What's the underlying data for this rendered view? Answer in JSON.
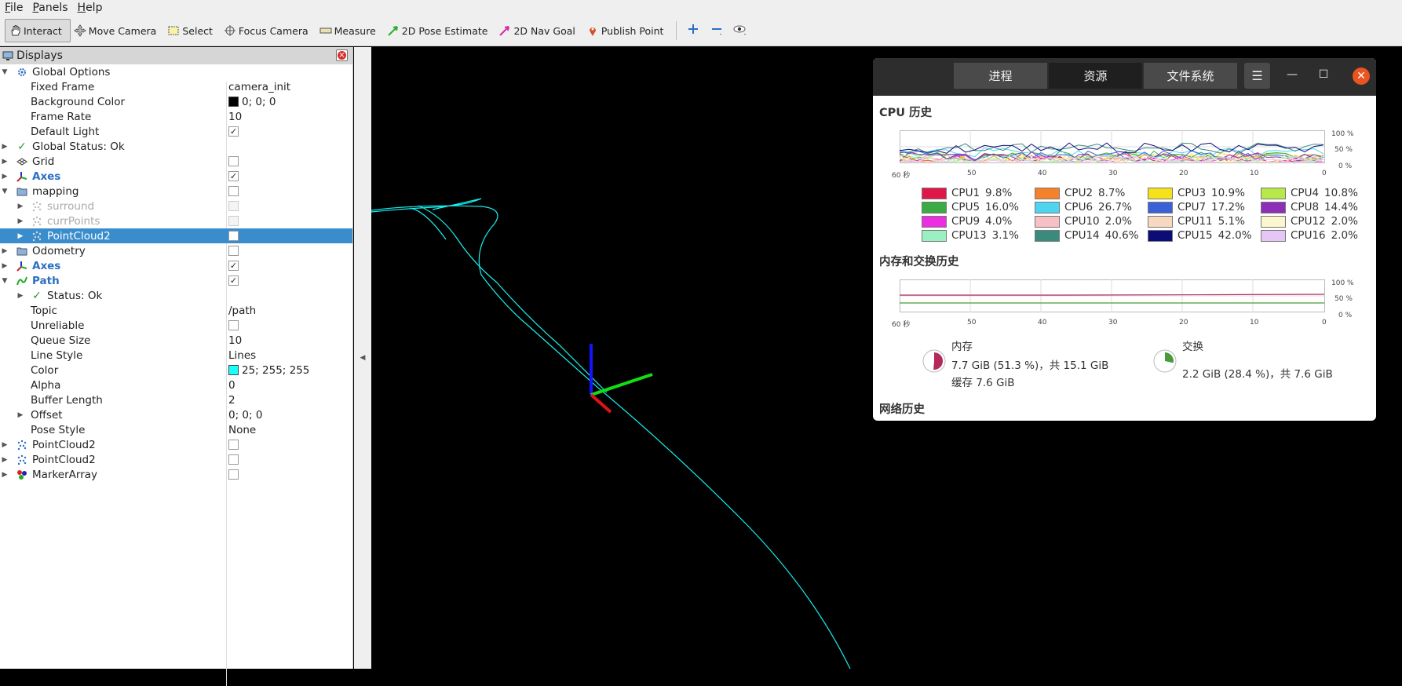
{
  "menubar": {
    "items": [
      {
        "label": "File",
        "mnemonic": "F",
        "rest": "ile"
      },
      {
        "label": "Panels",
        "mnemonic": "P",
        "rest": "anels"
      },
      {
        "label": "Help",
        "mnemonic": "H",
        "rest": "elp"
      }
    ]
  },
  "toolbar": {
    "interact": "Interact",
    "move_camera": "Move Camera",
    "select": "Select",
    "focus_camera": "Focus Camera",
    "measure": "Measure",
    "pose_estimate": "2D Pose Estimate",
    "nav_goal": "2D Nav Goal",
    "publish_point": "Publish Point"
  },
  "displays": {
    "title": "Displays",
    "rows": {
      "global_options": "Global Options",
      "fixed_frame": "Fixed Frame",
      "fixed_frame_val": "camera_init",
      "background_color": "Background Color",
      "background_color_val": "0; 0; 0",
      "frame_rate": "Frame Rate",
      "frame_rate_val": "10",
      "default_light": "Default Light",
      "global_status": "Global Status: Ok",
      "grid": "Grid",
      "axes": "Axes",
      "mapping": "mapping",
      "surround": "surround",
      "currpoints": "currPoints",
      "pointcloud2_sel": "PointCloud2",
      "odometry": "Odometry",
      "axes2": "Axes",
      "path": "Path",
      "status_ok": "Status: Ok",
      "topic": "Topic",
      "topic_val": "/path",
      "unreliable": "Unreliable",
      "queue_size": "Queue Size",
      "queue_size_val": "10",
      "line_style": "Line Style",
      "line_style_val": "Lines",
      "color": "Color",
      "color_val": "25; 255; 255",
      "alpha": "Alpha",
      "alpha_val": "0",
      "buffer_length": "Buffer Length",
      "buffer_length_val": "2",
      "offset": "Offset",
      "offset_val": "0; 0; 0",
      "pose_style": "Pose Style",
      "pose_style_val": "None",
      "pointcloud2_a": "PointCloud2",
      "pointcloud2_b": "PointCloud2",
      "marker_array": "MarkerArray"
    }
  },
  "sysmon": {
    "tabs": [
      "进程",
      "资源",
      "文件系统"
    ],
    "cpu_title": "CPU 历史",
    "mem_title": "内存和交换历史",
    "net_title": "网络历史",
    "y_ticks": [
      "100 %",
      "50 %",
      "0 %"
    ],
    "x_ticks": [
      "60 秒",
      "50",
      "40",
      "30",
      "20",
      "10",
      "0"
    ],
    "cpus": [
      {
        "label": "CPU1",
        "value": "9.8%",
        "color": "#e0184a"
      },
      {
        "label": "CPU2",
        "value": "8.7%",
        "color": "#f5822a"
      },
      {
        "label": "CPU3",
        "value": "10.9%",
        "color": "#f7e11a"
      },
      {
        "label": "CPU4",
        "value": "10.8%",
        "color": "#b8e84a"
      },
      {
        "label": "CPU5",
        "value": "16.0%",
        "color": "#3aab45"
      },
      {
        "label": "CPU6",
        "value": "26.7%",
        "color": "#4dd5f0"
      },
      {
        "label": "CPU7",
        "value": "17.2%",
        "color": "#3a62d6"
      },
      {
        "label": "CPU8",
        "value": "14.4%",
        "color": "#8e2db8"
      },
      {
        "label": "CPU9",
        "value": "4.0%",
        "color": "#ea2ee0"
      },
      {
        "label": "CPU10",
        "value": "2.0%",
        "color": "#f6c0c4"
      },
      {
        "label": "CPU11",
        "value": "5.1%",
        "color": "#f9d8c2"
      },
      {
        "label": "CPU12",
        "value": "2.0%",
        "color": "#fbf6cd"
      },
      {
        "label": "CPU13",
        "value": "3.1%",
        "color": "#9af0c0"
      },
      {
        "label": "CPU14",
        "value": "40.6%",
        "color": "#3a8a7e"
      },
      {
        "label": "CPU15",
        "value": "42.0%",
        "color": "#0c0c78"
      },
      {
        "label": "CPU16",
        "value": "2.0%",
        "color": "#e5c6f5"
      }
    ],
    "memory": {
      "label": "内存",
      "line1": "7.7 GiB (51.3 %)，共 15.1 GiB",
      "line2": "缓存 7.6 GiB",
      "percent": 51.3,
      "color": "#b5285b"
    },
    "swap": {
      "label": "交换",
      "line1": "2.2 GiB (28.4 %)，共 7.6 GiB",
      "percent": 28.4,
      "color": "#4a9a3a"
    }
  }
}
